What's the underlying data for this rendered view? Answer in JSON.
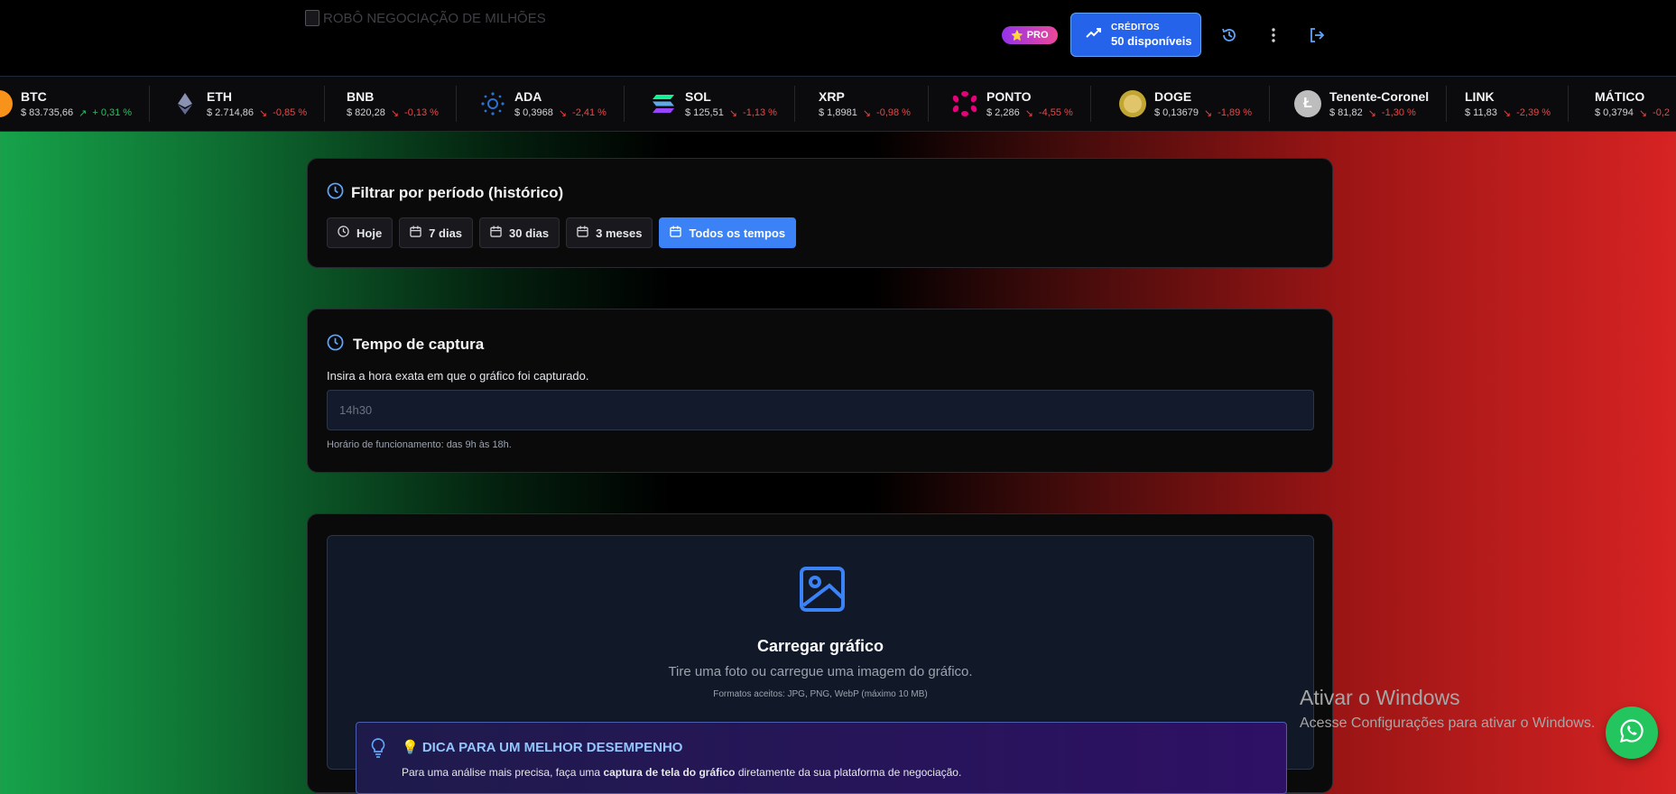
{
  "header": {
    "logo_alt": "ROBÔ NEGOCIAÇÃO DE MILHÕES",
    "pro_label": "PRO",
    "credits_label": "CRÉDITOS",
    "credits_value": "50 disponíveis",
    "icons": [
      "history-icon",
      "more-vertical-icon",
      "logout-icon"
    ]
  },
  "ticker": [
    {
      "symbol": "BTC",
      "price": "$ 83.735,66",
      "change": "+ 0,31 %",
      "trend": "up"
    },
    {
      "symbol": "ETH",
      "price": "$ 2.714,86",
      "change": "-0,85 %",
      "trend": "down"
    },
    {
      "symbol": "BNB",
      "price": "$ 820,28",
      "change": "-0,13 %",
      "trend": "down"
    },
    {
      "symbol": "ADA",
      "price": "$ 0,3968",
      "change": "-2,41 %",
      "trend": "down"
    },
    {
      "symbol": "SOL",
      "price": "$ 125,51",
      "change": "-1,13 %",
      "trend": "down"
    },
    {
      "symbol": "XRP",
      "price": "$ 1,8981",
      "change": "-0,98 %",
      "trend": "down"
    },
    {
      "symbol": "PONTO",
      "price": "$ 2,286",
      "change": "-4,55 %",
      "trend": "down"
    },
    {
      "symbol": "DOGE",
      "price": "$ 0,13679",
      "change": "-1,89 %",
      "trend": "down"
    },
    {
      "symbol": "Tenente-Coronel",
      "price": "$ 81,82",
      "change": "-1,30 %",
      "trend": "down"
    },
    {
      "symbol": "LINK",
      "price": "$ 11,83",
      "change": "-2,39 %",
      "trend": "down"
    },
    {
      "symbol": "MÁTICO",
      "price": "$ 0,3794",
      "change": "-0,2",
      "trend": "down"
    }
  ],
  "filter": {
    "title": "Filtrar por período (histórico)",
    "buttons": [
      "Hoje",
      "7 dias",
      "30 dias",
      "3 meses",
      "Todos os tempos"
    ],
    "active": "Todos os tempos"
  },
  "capture": {
    "title": "Tempo de captura",
    "description": "Insira a hora exata em que o gráfico foi capturado.",
    "placeholder": "14h30",
    "hint": "Horário de funcionamento: das 9h às 18h."
  },
  "upload": {
    "title": "Carregar gráfico",
    "subtitle": "Tire uma foto ou carregue uma imagem do gráfico.",
    "formats": "Formatos aceitos: JPG, PNG, WebP (máximo 10 MB)",
    "tip_title": "💡 DICA PARA UM MELHOR DESEMPENHO",
    "tip_text_pre": "Para uma análise mais precisa, faça uma ",
    "tip_text_bold": "captura de tela do gráfico",
    "tip_text_post": " diretamente da sua plataforma de negociação."
  },
  "watermark": {
    "title": "Ativar o Windows",
    "subtitle": "Acesse Configurações para ativar o Windows."
  },
  "colors": {
    "accent": "#3b82f6",
    "up": "#22c55e",
    "down": "#ef4444",
    "whatsapp": "#22c55e"
  }
}
